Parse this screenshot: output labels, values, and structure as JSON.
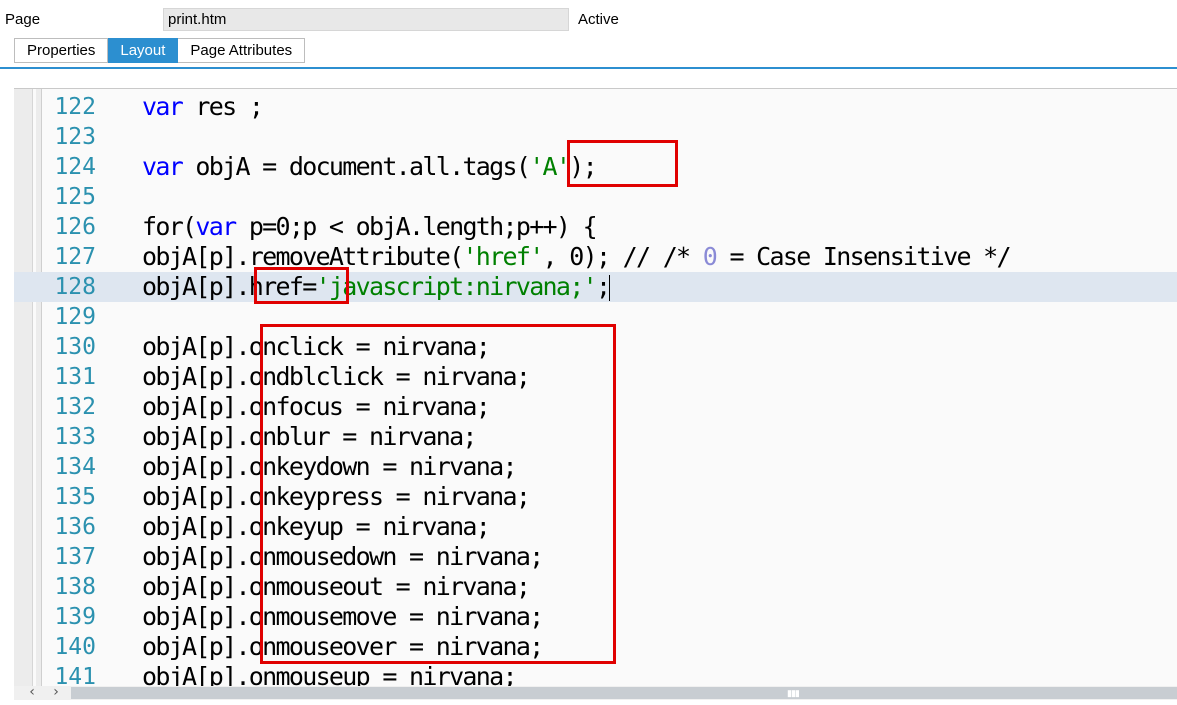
{
  "header": {
    "label": "Page",
    "file_name": "print.htm",
    "status": "Active"
  },
  "tabs": [
    {
      "label": "Properties",
      "active": false
    },
    {
      "label": "Layout",
      "active": true
    },
    {
      "label": "Page Attributes",
      "active": false
    }
  ],
  "editor": {
    "current_line": 128,
    "lines": [
      {
        "num": "122",
        "segments": [
          {
            "t": "kw",
            "text": "var"
          },
          {
            "t": "plain",
            "text": " res ;"
          }
        ]
      },
      {
        "num": "123",
        "segments": []
      },
      {
        "num": "124",
        "segments": [
          {
            "t": "kw",
            "text": "var"
          },
          {
            "t": "plain",
            "text": " objA = document.all.tags("
          },
          {
            "t": "str",
            "text": "'A'"
          },
          {
            "t": "plain",
            "text": ");"
          }
        ]
      },
      {
        "num": "125",
        "segments": []
      },
      {
        "num": "126",
        "segments": [
          {
            "t": "plain",
            "text": "for("
          },
          {
            "t": "kw",
            "text": "var"
          },
          {
            "t": "plain",
            "text": " p=0;p < objA.length;p++) {"
          }
        ]
      },
      {
        "num": "127",
        "segments": [
          {
            "t": "plain",
            "text": "objA[p].removeAttribute("
          },
          {
            "t": "str",
            "text": "'href'"
          },
          {
            "t": "plain",
            "text": ", 0); // /* "
          },
          {
            "t": "num",
            "text": "0"
          },
          {
            "t": "plain",
            "text": " = Case Insensitive */"
          }
        ]
      },
      {
        "num": "128",
        "segments": [
          {
            "t": "plain",
            "text": "objA[p].href="
          },
          {
            "t": "str",
            "text": "'javascript:nirvana;'"
          },
          {
            "t": "plain",
            "text": ";"
          }
        ]
      },
      {
        "num": "129",
        "segments": []
      },
      {
        "num": "130",
        "segments": [
          {
            "t": "plain",
            "text": "objA[p].onclick = nirvana;"
          }
        ]
      },
      {
        "num": "131",
        "segments": [
          {
            "t": "plain",
            "text": "objA[p].ondblclick = nirvana;"
          }
        ]
      },
      {
        "num": "132",
        "segments": [
          {
            "t": "plain",
            "text": "objA[p].onfocus = nirvana;"
          }
        ]
      },
      {
        "num": "133",
        "segments": [
          {
            "t": "plain",
            "text": "objA[p].onblur = nirvana;"
          }
        ]
      },
      {
        "num": "134",
        "segments": [
          {
            "t": "plain",
            "text": "objA[p].onkeydown = nirvana;"
          }
        ]
      },
      {
        "num": "135",
        "segments": [
          {
            "t": "plain",
            "text": "objA[p].onkeypress = nirvana;"
          }
        ]
      },
      {
        "num": "136",
        "segments": [
          {
            "t": "plain",
            "text": "objA[p].onkeyup = nirvana;"
          }
        ]
      },
      {
        "num": "137",
        "segments": [
          {
            "t": "plain",
            "text": "objA[p].onmousedown = nirvana;"
          }
        ]
      },
      {
        "num": "138",
        "segments": [
          {
            "t": "plain",
            "text": "objA[p].onmouseout = nirvana;"
          }
        ]
      },
      {
        "num": "139",
        "segments": [
          {
            "t": "plain",
            "text": "objA[p].onmousemove = nirvana;"
          }
        ]
      },
      {
        "num": "140",
        "segments": [
          {
            "t": "plain",
            "text": "objA[p].onmouseover = nirvana;"
          }
        ]
      },
      {
        "num": "141",
        "segments": [
          {
            "t": "plain",
            "text": "objA[p].onmouseup = nirvana;"
          }
        ]
      }
    ]
  },
  "colors": {
    "accent": "#2c8fd0",
    "keyword": "#0000ff",
    "string": "#008000",
    "line_number": "#2b91af",
    "highlight_box": "#e00000",
    "current_line_bg": "#dee6f0"
  },
  "scrollbar": {
    "left_icon": "chevron-left-icon",
    "right_icon": "chevron-right-icon"
  }
}
